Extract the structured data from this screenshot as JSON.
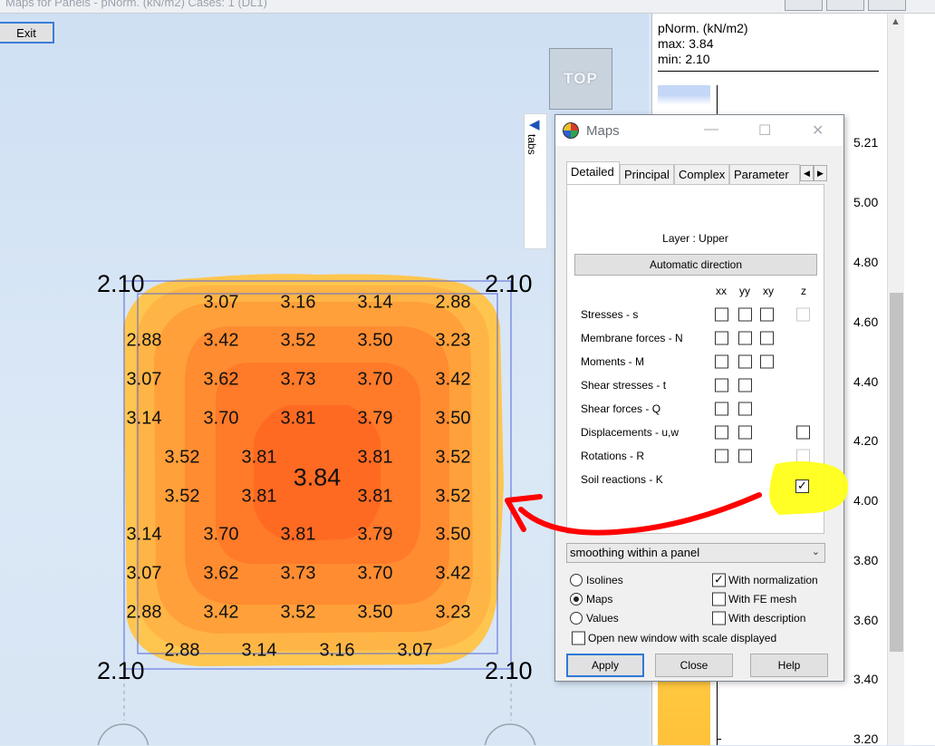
{
  "window": {
    "title": "Maps for Panels - pNorm. (kN/m2) Cases: 1 (DL1)"
  },
  "toolbar": {
    "exit_label": "Exit"
  },
  "view": {
    "cube_label": "TOP",
    "tabs_label": "tabs"
  },
  "map": {
    "corner_values": [
      "2.10",
      "2.10",
      "2.10",
      "2.10"
    ],
    "center_value": "3.84",
    "values": [
      "3.07",
      "3.16",
      "3.14",
      "2.88",
      "2.88",
      "3.42",
      "3.52",
      "3.50",
      "3.23",
      "3.07",
      "3.62",
      "3.73",
      "3.70",
      "3.42",
      "3.14",
      "3.70",
      "3.81",
      "3.79",
      "3.50",
      "3.52",
      "3.81",
      "3.81",
      "3.52",
      "3.52",
      "3.81",
      "3.81",
      "3.52",
      "3.14",
      "3.70",
      "3.81",
      "3.79",
      "3.50",
      "3.07",
      "3.62",
      "3.73",
      "3.70",
      "3.42",
      "2.88",
      "3.42",
      "3.52",
      "3.50",
      "3.23",
      "2.88",
      "3.14",
      "3.16",
      "3.07"
    ]
  },
  "scale_panel": {
    "title": "pNorm. (kN/m2)",
    "max": "max: 3.84",
    "min": "min: 2.10",
    "ticks": [
      "5.21",
      "5.00",
      "4.80",
      "4.60",
      "4.40",
      "4.20",
      "4.00",
      "3.80",
      "3.60",
      "3.40",
      "3.20"
    ]
  },
  "maps_dialog": {
    "title": "Maps",
    "tabs": [
      "Detailed",
      "Principal",
      "Complex",
      "Parameter"
    ],
    "layer_label": "Layer : Upper",
    "auto_direction_label": "Automatic direction",
    "columns": [
      "xx",
      "yy",
      "xy",
      "z"
    ],
    "rows": [
      "Stresses - s",
      "Membrane forces - N",
      "Moments - M",
      "Shear stresses - t",
      "Shear forces - Q",
      "Displacements - u,w",
      "Rotations - R",
      "Soil reactions - K"
    ],
    "checked": {
      "soil_reactions_z": true
    },
    "smoothing_value": "smoothing within a panel",
    "options": {
      "isolines": "Isolines",
      "maps": "Maps",
      "values": "Values",
      "selected": "Maps"
    },
    "checks": {
      "with_normalization": "With normalization",
      "with_fe_mesh": "With FE mesh",
      "with_description": "With description",
      "open_new_window": "Open new window with scale displayed"
    },
    "check_states": {
      "with_normalization": true,
      "with_fe_mesh": false,
      "with_description": false,
      "open_new_window": false
    },
    "buttons": {
      "apply": "Apply",
      "close": "Close",
      "help": "Help"
    }
  },
  "colors": {
    "highlight": "#ffff1a",
    "arrow": "#ff0000",
    "map_outer": "#ffc04a",
    "map_inner": "#ff6f20"
  }
}
